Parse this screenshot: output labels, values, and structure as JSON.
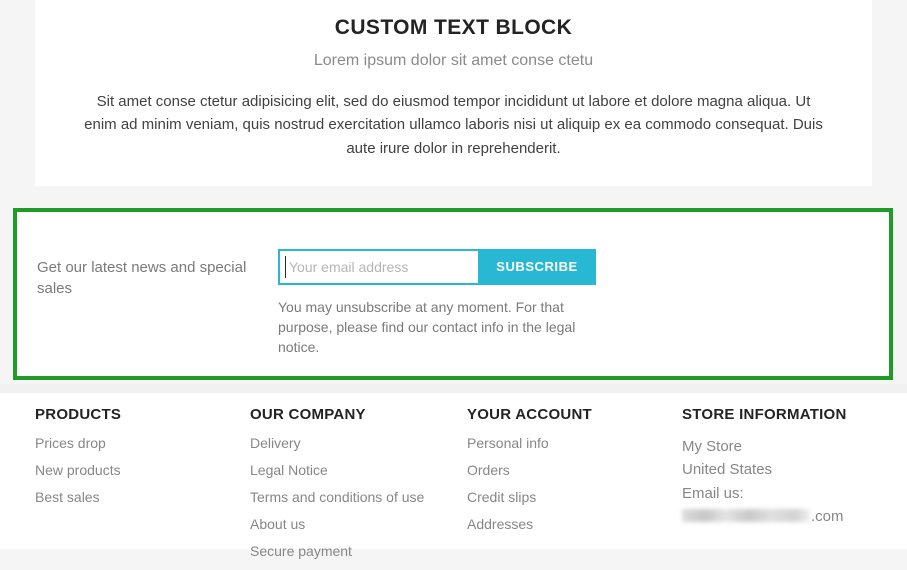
{
  "colors": {
    "page_background": "#f5f5f5",
    "block_background": "#ffffff",
    "highlight_outline": "#1f9b27",
    "accent_cyan": "#29b8d4",
    "heading_dark": "#232323",
    "muted_text": "#878787",
    "body_text": "#414141"
  },
  "text_block": {
    "title": "CUSTOM TEXT BLOCK",
    "subtitle": "Lorem ipsum dolor sit amet conse ctetu",
    "body": "Sit amet conse ctetur adipisicing elit, sed do eiusmod tempor incididunt ut labore et dolore magna aliqua. Ut enim ad minim veniam, quis nostrud exercitation ullamco laboris nisi ut aliquip ex ea commodo consequat. Duis aute irure dolor in reprehenderit."
  },
  "newsletter": {
    "label": "Get our latest news and special sales",
    "email_value": "",
    "email_placeholder": "Your email address",
    "submit_label": "SUBSCRIBE",
    "legal": "You may unsubscribe at any moment. For that purpose, please find our contact info in the legal notice."
  },
  "footer": {
    "columns": [
      {
        "heading": "PRODUCTS",
        "links": [
          "Prices drop",
          "New products",
          "Best sales"
        ]
      },
      {
        "heading": "OUR COMPANY",
        "links": [
          "Delivery",
          "Legal Notice",
          "Terms and conditions of use",
          "About us",
          "Secure payment"
        ]
      },
      {
        "heading": "YOUR ACCOUNT",
        "links": [
          "Personal info",
          "Orders",
          "Credit slips",
          "Addresses"
        ]
      }
    ],
    "store_information": {
      "heading": "STORE INFORMATION",
      "store_name": "My Store",
      "country": "United States",
      "email_label": "Email us:",
      "email_redacted": true,
      "email_visible_suffix": ".com"
    }
  }
}
